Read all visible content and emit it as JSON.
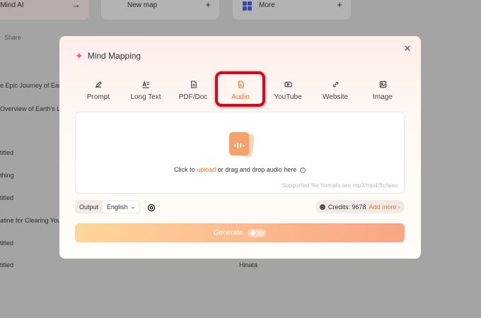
{
  "background": {
    "cards": [
      {
        "label": "ritMind AI",
        "icon": "arrow-right-icon"
      },
      {
        "label": "New map",
        "icon": "plus-icon"
      },
      {
        "label": "More",
        "icon": "plus-icon"
      }
    ],
    "share_label": "Share",
    "rows": [
      "e Epic Journey of Earth:",
      "Overview of Earth's Lay",
      "",
      "titled",
      "thing",
      "titled",
      "atine for Clearing Your",
      "titled",
      "titled"
    ],
    "owner": "Hinata"
  },
  "modal": {
    "title": "Mind Mapping",
    "tabs": [
      {
        "label": "Prompt",
        "icon": "pen-icon"
      },
      {
        "label": "Long Text",
        "icon": "text-icon"
      },
      {
        "label": "PDF/Doc",
        "icon": "document-icon"
      },
      {
        "label": "Audio",
        "icon": "audio-file-icon",
        "active": true
      },
      {
        "label": "YouTube",
        "icon": "youtube-icon"
      },
      {
        "label": "Website",
        "icon": "link-icon"
      },
      {
        "label": "Image",
        "icon": "image-icon"
      }
    ],
    "dropzone": {
      "prefix": "Click to ",
      "link": "upload",
      "suffix": " or drag and drop audio here",
      "formats": "Supported file formats are mp3/mp4/flc/wav."
    },
    "output_label": "Output",
    "language": "English",
    "credits_label": "Credits: 9678",
    "add_more": "Add more",
    "add_more_chevron": "›",
    "generate_label": "Generate",
    "generate_cost": "30"
  },
  "colors": {
    "accent": "#f0742b",
    "highlight": "#e3001b"
  }
}
